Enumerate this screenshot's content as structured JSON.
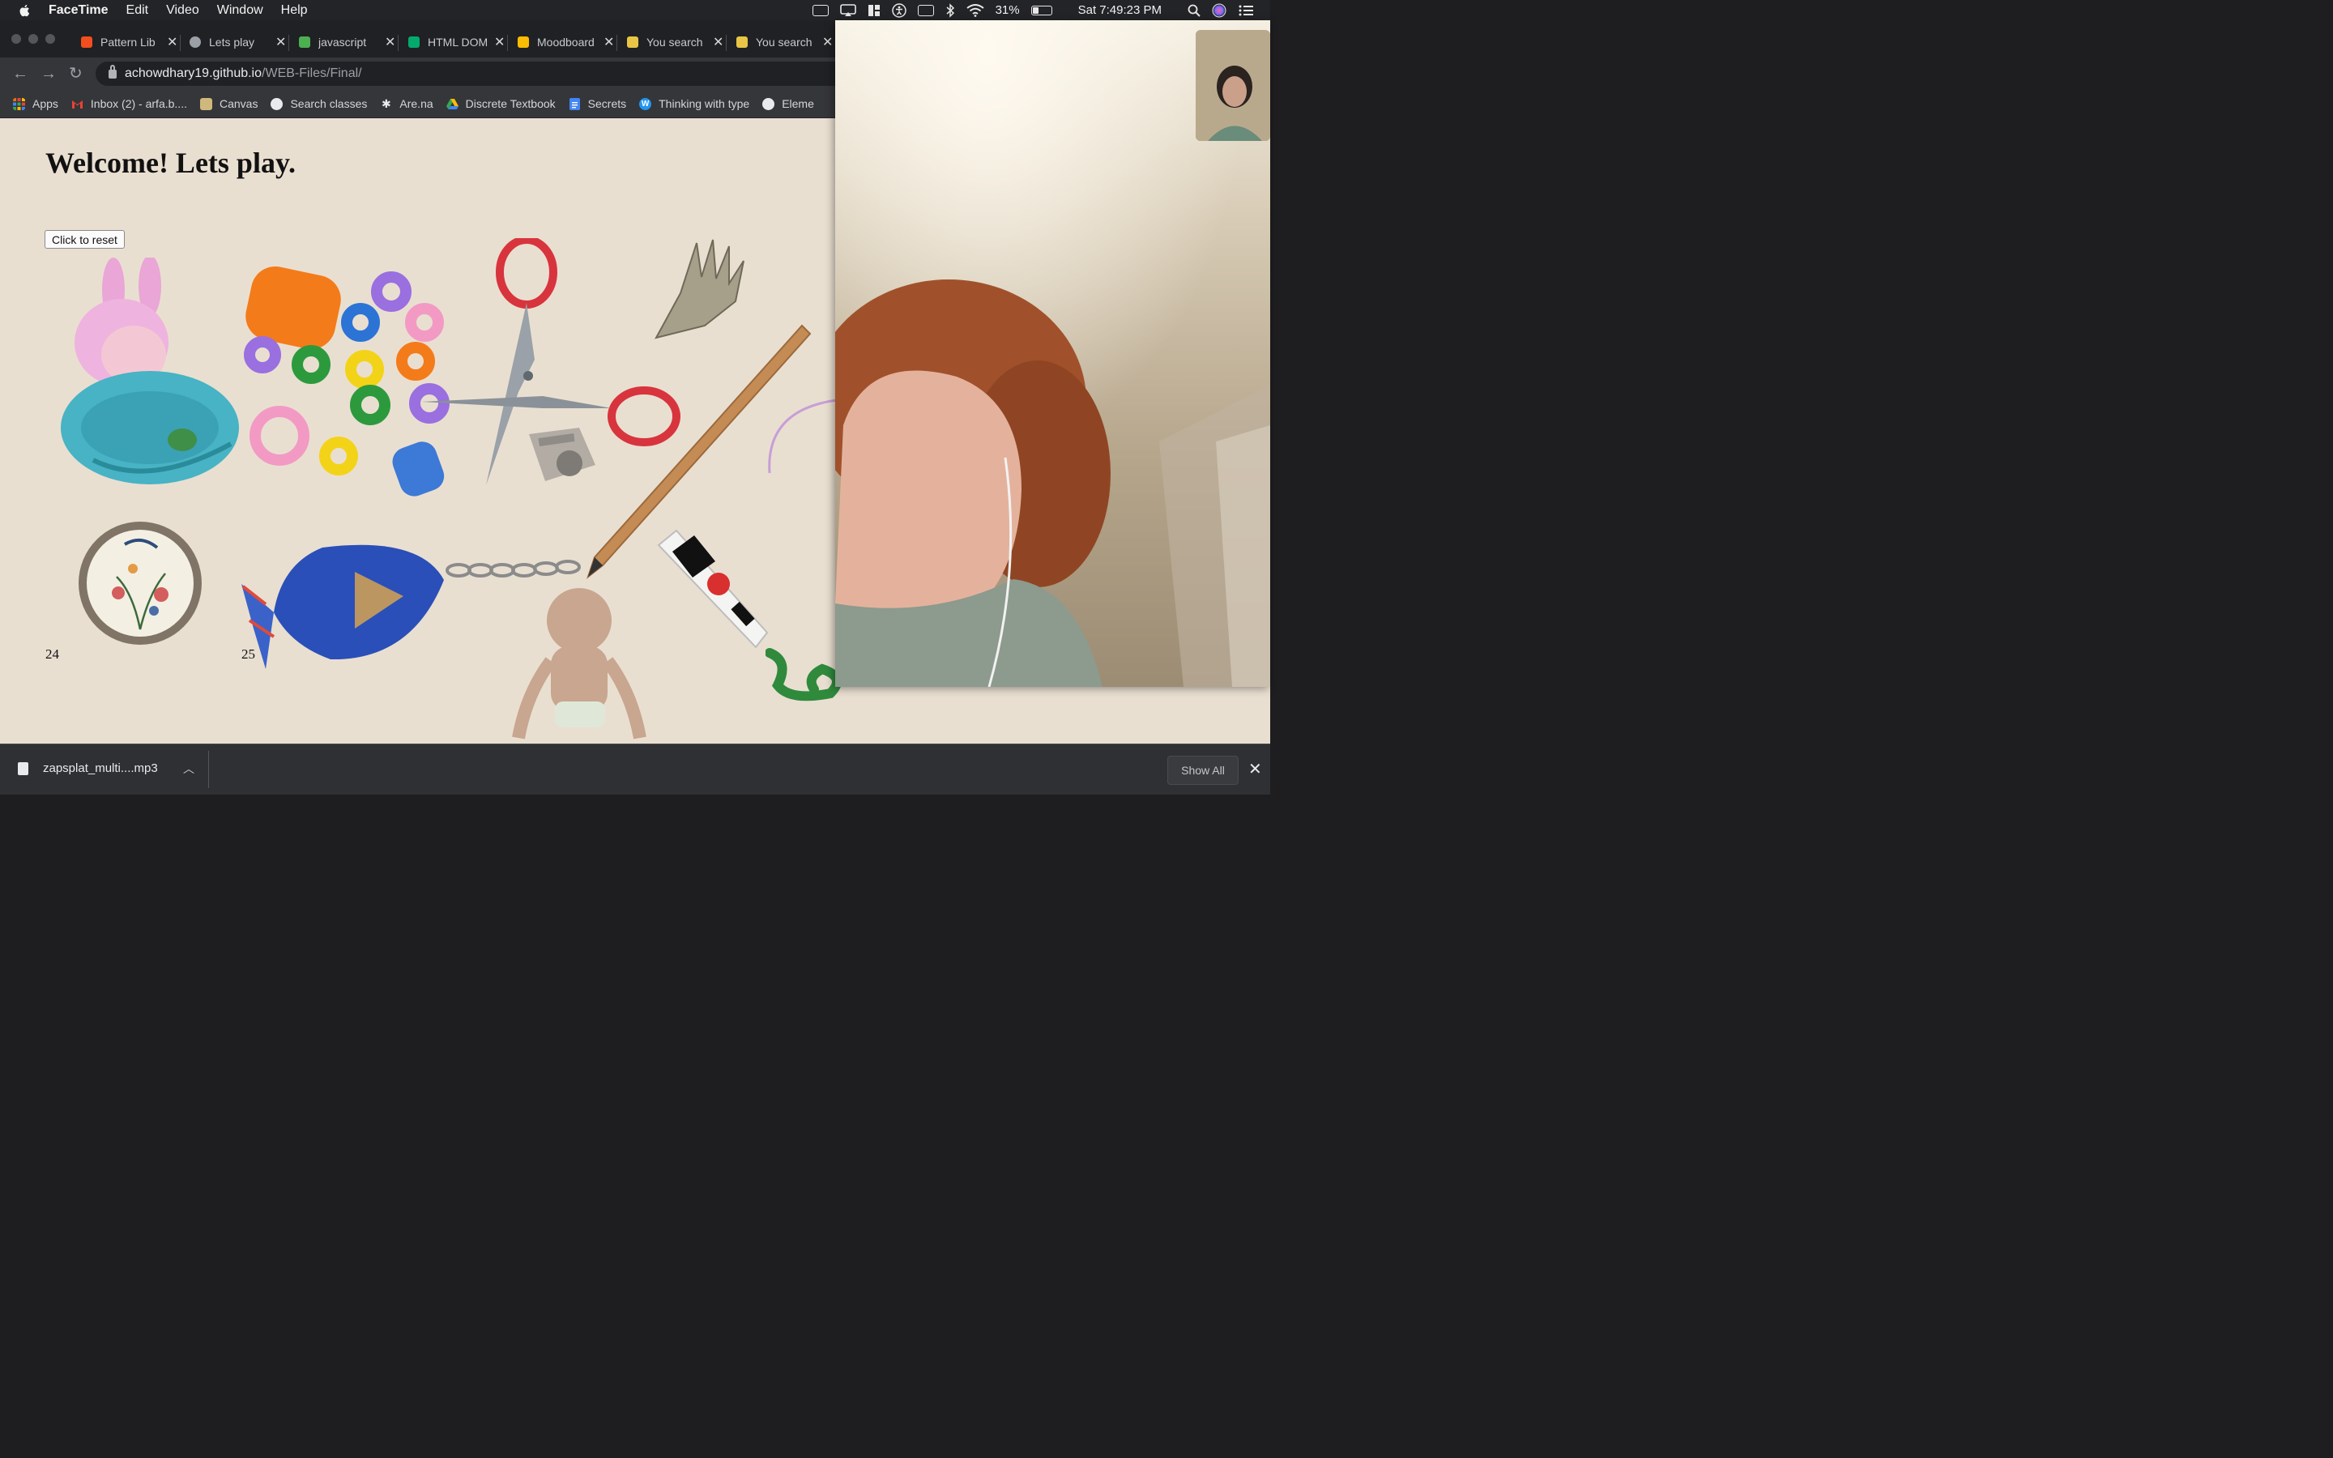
{
  "menubar": {
    "app_name": "FaceTime",
    "menus": [
      "Edit",
      "Video",
      "Window",
      "Help"
    ],
    "battery": "31%",
    "clock": "Sat 7:49:23 PM"
  },
  "tabs": [
    {
      "title": "Pattern Lib",
      "favicon_color": "#f24e1e"
    },
    {
      "title": "Lets play",
      "favicon_color": "#9aa0a6"
    },
    {
      "title": "javascript",
      "favicon_color": "#4caf50"
    },
    {
      "title": "HTML DOM",
      "favicon_color": "#04aa6d"
    },
    {
      "title": "Moodboard",
      "favicon_color": "#fbbc04"
    },
    {
      "title": "You search",
      "favicon_color": "#e8c547"
    },
    {
      "title": "You search",
      "favicon_color": "#e8c547"
    }
  ],
  "address_bar": {
    "host": "achowdhary19.github.io",
    "path": "/WEB-Files/Final/"
  },
  "bookmarks": [
    {
      "label": "Apps",
      "icon": "apps-grid-icon",
      "color": "#e8710a"
    },
    {
      "label": "Inbox (2) - arfa.b....",
      "icon": "gmail-icon",
      "color": "#ea4335"
    },
    {
      "label": "Canvas",
      "icon": "canvas-icon",
      "color": "#cfb87c"
    },
    {
      "label": "Search classes",
      "icon": "globe-icon",
      "color": "#e8eaed"
    },
    {
      "label": "Are.na",
      "icon": "arena-icon",
      "color": "#111111"
    },
    {
      "label": "Discrete Textbook",
      "icon": "drive-icon",
      "color": "#34a853"
    },
    {
      "label": "Secrets",
      "icon": "docs-icon",
      "color": "#4285f4"
    },
    {
      "label": "Thinking with type",
      "icon": "wordpress-icon",
      "color": "#2196f3"
    },
    {
      "label": "Eleme",
      "icon": "globe-icon",
      "color": "#e8eaed"
    }
  ],
  "page": {
    "heading": "Welcome! Lets play.",
    "reset_button": "Click to reset",
    "labels": [
      "24",
      "25"
    ],
    "background": "#e9dfd1"
  },
  "downloads": {
    "file_name": "zapsplat_multi....mp3",
    "show_all": "Show All"
  }
}
